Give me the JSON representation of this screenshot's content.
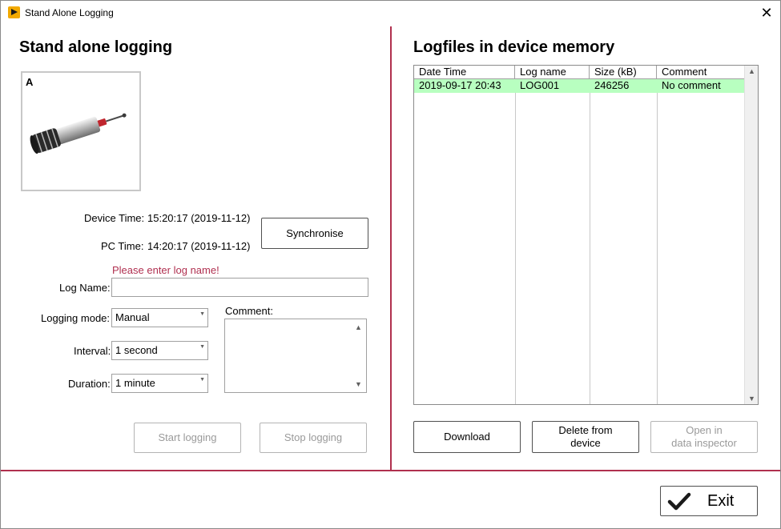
{
  "window": {
    "title": "Stand Alone Logging",
    "close_glyph": "✕"
  },
  "left": {
    "title": "Stand alone logging",
    "device_letter": "A",
    "device_time_label": "Device Time:",
    "device_time_value": "15:20:17 (2019-11-12)",
    "pc_time_label": "PC Time:",
    "pc_time_value": "14:20:17 (2019-11-12)",
    "sync_label": "Synchronise",
    "warning": "Please enter log name!",
    "log_name_label": "Log Name:",
    "log_name_value": "",
    "logging_mode_label": "Logging mode:",
    "logging_mode_value": "Manual",
    "interval_label": "Interval:",
    "interval_value": "1 second",
    "duration_label": "Duration:",
    "duration_value": "1 minute",
    "comment_label": "Comment:",
    "comment_value": "",
    "start_label": "Start logging",
    "stop_label": "Stop logging"
  },
  "right": {
    "title": "Logfiles in device memory",
    "table": {
      "columns": [
        "Date Time",
        "Log name",
        "Size (kB)",
        "Comment"
      ],
      "rows": [
        [
          "2019-09-17 20:43",
          "LOG001",
          "246256",
          "No comment"
        ]
      ]
    },
    "download_label": "Download",
    "delete_label": "Delete from\ndevice",
    "open_label": "Open in\ndata inspector"
  },
  "footer": {
    "exit_label": "Exit"
  },
  "colors": {
    "accent": "#b0304e",
    "selected_row": "#b8ffc0",
    "warning": "#b03050"
  },
  "icons": {
    "app": "labview-app-icon",
    "close": "close-icon",
    "exit": "checkmark-icon"
  }
}
